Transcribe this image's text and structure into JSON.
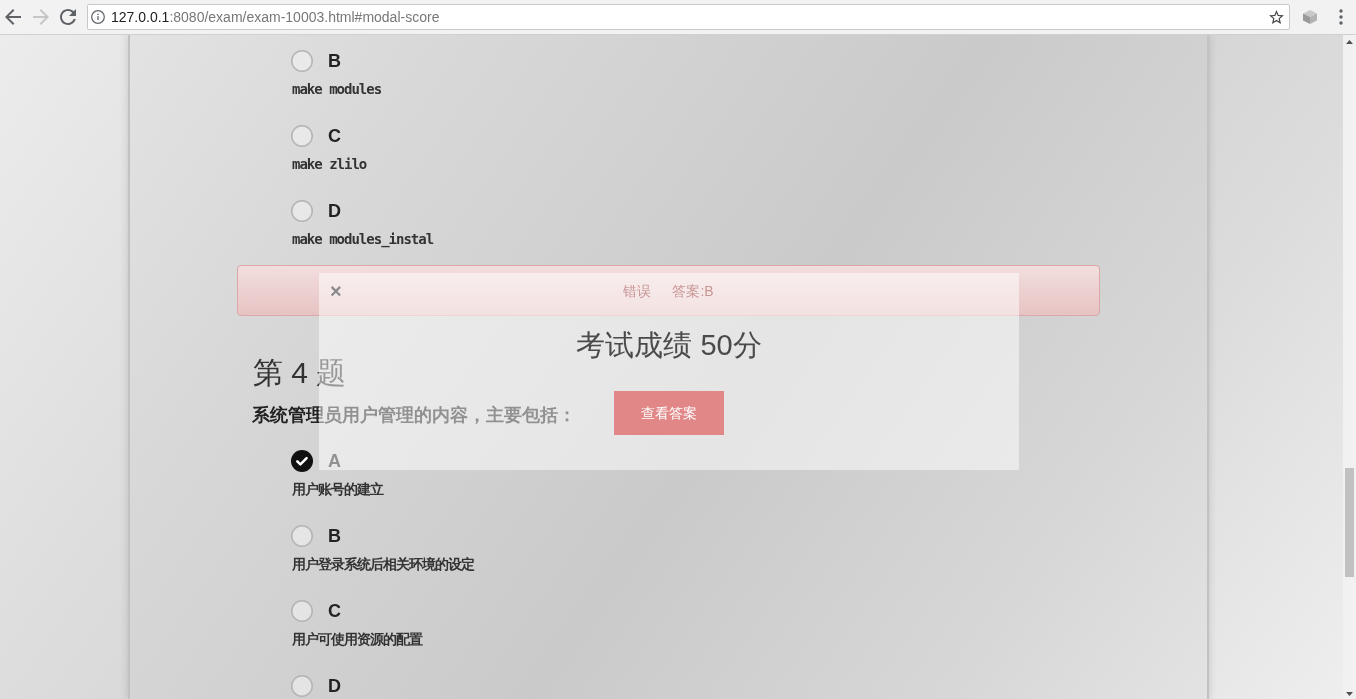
{
  "browser": {
    "nav_buttons": [
      {
        "kind": "back",
        "disabled": false
      },
      {
        "kind": "forward",
        "disabled": true
      },
      {
        "kind": "reload",
        "disabled": false
      }
    ],
    "url": {
      "host": "127.0.0.1",
      "rest": ":8080/exam/exam-10003.html#modal-score"
    }
  },
  "questions": [
    {
      "options": [
        {
          "letter": "B",
          "text": "make modules",
          "selected": false
        },
        {
          "letter": "C",
          "text": "make zlilo",
          "selected": false
        },
        {
          "letter": "D",
          "text": "make modules_instal",
          "selected": false
        }
      ],
      "result": {
        "correct": false,
        "verdict": "错误",
        "answer": "答案:B"
      }
    },
    {
      "heading": "第 4 题",
      "prompt": "系统管理员用户管理的内容，主要包括：",
      "options": [
        {
          "letter": "A",
          "text": "用户账号的建立",
          "selected": true
        },
        {
          "letter": "B",
          "text": "用户登录系统后相关环境的设定",
          "selected": false
        },
        {
          "letter": "C",
          "text": "用户可使用资源的配置",
          "selected": false
        },
        {
          "letter": "D",
          "selected": false
        }
      ]
    }
  ],
  "modal": {
    "close": "×",
    "title": "考试成绩 50分",
    "button": "查看答案"
  }
}
